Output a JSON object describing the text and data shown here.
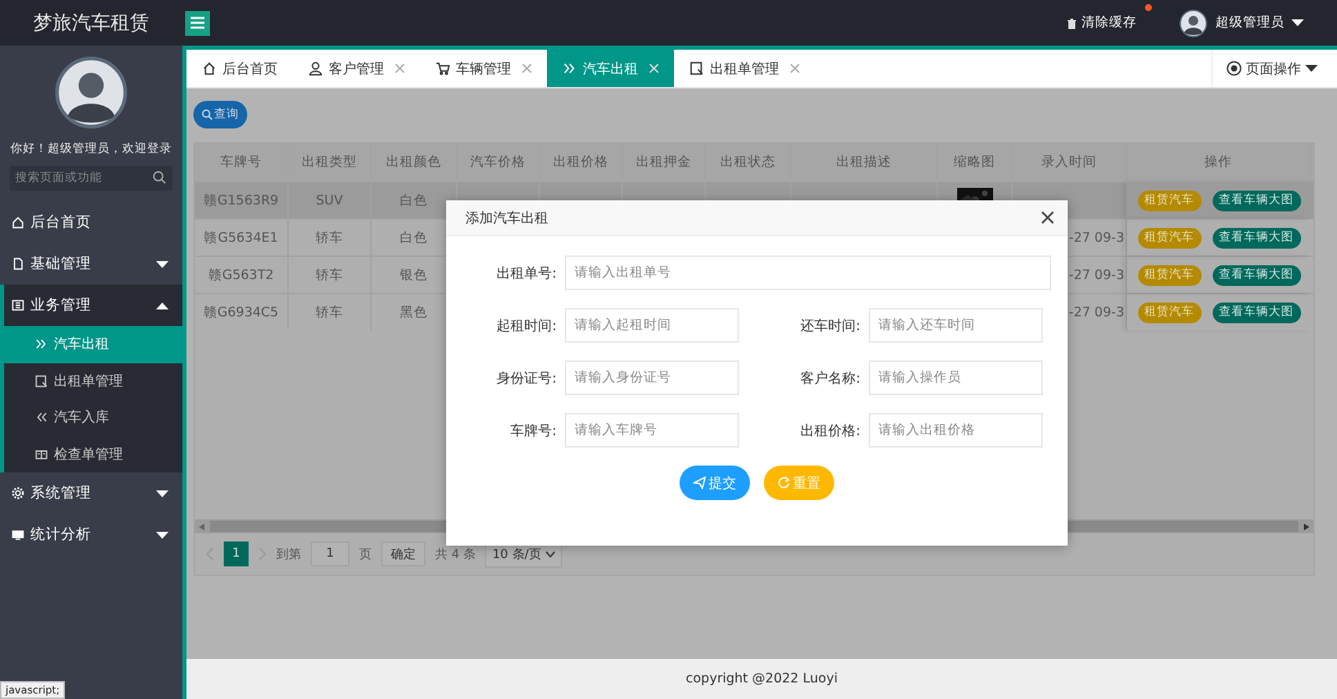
{
  "app": {
    "title": "梦旅汽车租赁"
  },
  "header": {
    "clear_cache": "清除缓存",
    "user": "超级管理员"
  },
  "sidebar": {
    "greeting": "你好！超级管理员，欢迎登录",
    "search": {
      "placeholder": "搜索页面或功能"
    },
    "items": [
      {
        "label": "后台首页",
        "kind": "link"
      },
      {
        "label": "基础管理",
        "kind": "group",
        "expanded": false
      },
      {
        "label": "业务管理",
        "kind": "group",
        "expanded": true,
        "children": [
          {
            "label": "汽车出租",
            "selected": true
          },
          {
            "label": "出租单管理",
            "selected": false
          },
          {
            "label": "汽车入库",
            "selected": false
          },
          {
            "label": "检查单管理",
            "selected": false
          }
        ]
      },
      {
        "label": "系统管理",
        "kind": "group",
        "expanded": false
      },
      {
        "label": "统计分析",
        "kind": "group",
        "expanded": false
      }
    ]
  },
  "tabs": [
    {
      "label": "后台首页",
      "closable": false,
      "selected": false
    },
    {
      "label": "客户管理",
      "closable": true,
      "selected": false
    },
    {
      "label": "车辆管理",
      "closable": true,
      "selected": false
    },
    {
      "label": "汽车出租",
      "closable": true,
      "selected": true
    },
    {
      "label": "出租单管理",
      "closable": true,
      "selected": false
    }
  ],
  "page_ops": "页面操作",
  "search_button": "查询",
  "table": {
    "columns": [
      "车牌号",
      "出租类型",
      "出租颜色",
      "汽车价格",
      "出租价格",
      "出租押金",
      "出租状态",
      "出租描述",
      "缩略图",
      "录入时间",
      "操作"
    ],
    "rows": [
      {
        "selected": true,
        "plate": "赣G1563R9",
        "type": "SUV",
        "paint": "白色",
        "actions": [
          "租赁汽车",
          "查看车辆大图"
        ]
      },
      {
        "selected": false,
        "plate": "赣G5634E1",
        "type": "轿车",
        "paint": "白色",
        "created": "-27 09-3",
        "actions": [
          "租赁汽车",
          "查看车辆大图"
        ]
      },
      {
        "selected": false,
        "plate": "赣G563T2",
        "type": "轿车",
        "paint": "银色",
        "created": "-27 09-3",
        "actions": [
          "租赁汽车",
          "查看车辆大图"
        ]
      },
      {
        "selected": false,
        "plate": "赣G6934C5",
        "type": "轿车",
        "paint": "黑色",
        "created": "-27 09-3",
        "actions": [
          "租赁汽车",
          "查看车辆大图"
        ]
      }
    ]
  },
  "pagination": {
    "pages": [
      {
        "label": "1",
        "selected": true
      }
    ],
    "goto_label": "到第",
    "goto_value": "1",
    "page_unit": "页",
    "confirm": "确定",
    "total": "共 4 条",
    "page_size": "10 条/页"
  },
  "dialog": {
    "title": "添加汽车出租",
    "rows": [
      [
        {
          "label": "出租单号:",
          "placeholder": "请输入出租单号"
        }
      ],
      [
        {
          "label": "起租时间:",
          "placeholder": "请输入起租时间"
        },
        {
          "label": "还车时间:",
          "placeholder": "请输入还车时间"
        }
      ],
      [
        {
          "label": "身份证号:",
          "placeholder": "请输入身份证号"
        },
        {
          "label": "客户名称:",
          "placeholder": "请输入操作员"
        }
      ],
      [
        {
          "label": "车牌号:",
          "placeholder": "请输入车牌号"
        },
        {
          "label": "出租价格:",
          "placeholder": "请输入出租价格"
        }
      ]
    ],
    "buttons": [
      {
        "label": "提交",
        "kind": "submit"
      },
      {
        "label": "重置",
        "kind": "reset"
      }
    ]
  },
  "footer": "copyright @2022 Luoyi",
  "status_text": "javascript;"
}
